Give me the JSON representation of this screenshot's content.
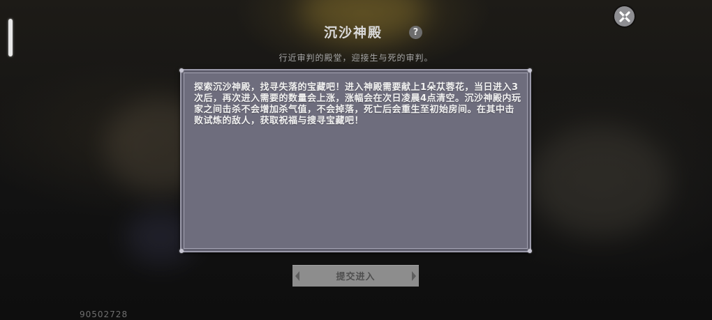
{
  "dialog": {
    "title": "沉沙神殿",
    "subtitle": "行近审判的殿堂，迎接生与死的审判。",
    "description": "探索沉沙神殿，找寻失落的宝藏吧！进入神殿需要献上1朵苁蓉花，当日进入3次后，再次进入需要的数量会上涨，涨幅会在次日凌晨4点清空。沉沙神殿内玩家之间击杀不会增加杀气值，不会掉落，死亡后会重生至初始房间。在其中击败试炼的敌人，获取祝福与搜寻宝藏吧！",
    "submit_label": "提交进入",
    "help_label": "?"
  },
  "footer": {
    "user_id": "90502728"
  },
  "icons": {
    "close": "close-icon",
    "help": "question-mark-icon",
    "side_handle": "side-handle-icon"
  },
  "colors": {
    "panel_bg": "#6e6d7d",
    "panel_border": "#9b9aaa",
    "button_bg": "#8d8d8d",
    "title_text": "#d9d9d9"
  }
}
